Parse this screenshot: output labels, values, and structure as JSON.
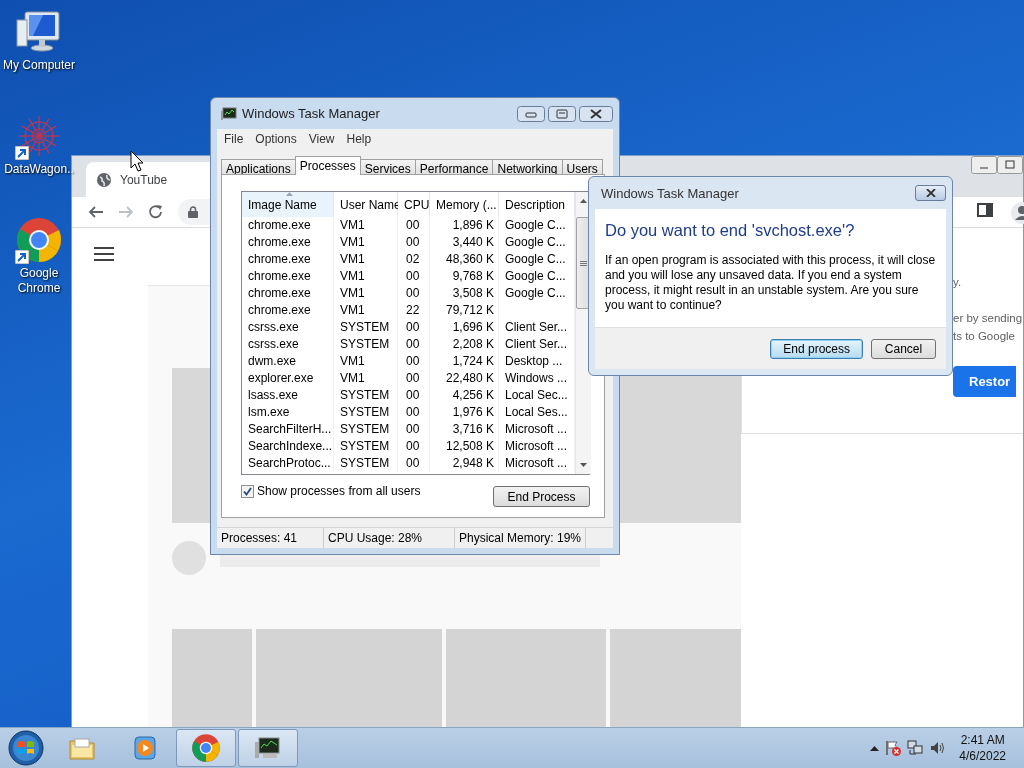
{
  "desktop_icons": [
    {
      "label": "My Computer",
      "kind": "computer",
      "shortcut": false
    },
    {
      "label": "DataWagon..",
      "kind": "network",
      "shortcut": true
    },
    {
      "label": "Google Chrome",
      "kind": "chrome",
      "shortcut": true
    }
  ],
  "browser": {
    "tab_title": "YouTube",
    "panel_texts": [
      "y.",
      "er by sending",
      "ts to Google"
    ],
    "panel_button": "Restor"
  },
  "task_manager": {
    "title": "Windows Task Manager",
    "menu": [
      "File",
      "Options",
      "View",
      "Help"
    ],
    "tabs": [
      {
        "label": "Applications",
        "selected": false
      },
      {
        "label": "Processes",
        "selected": true
      },
      {
        "label": "Services",
        "selected": false
      },
      {
        "label": "Performance",
        "selected": false
      },
      {
        "label": "Networking",
        "selected": false
      },
      {
        "label": "Users",
        "selected": false
      }
    ],
    "columns": [
      {
        "label": "Image Name",
        "sorted": true
      },
      {
        "label": "User Name",
        "sorted": false
      },
      {
        "label": "CPU",
        "sorted": false
      },
      {
        "label": "Memory (...",
        "sorted": false
      },
      {
        "label": "Description",
        "sorted": false
      }
    ],
    "rows": [
      {
        "name": "chrome.exe",
        "user": "VM1",
        "cpu": "00",
        "memory": "1,896 K",
        "description": "Google C..."
      },
      {
        "name": "chrome.exe",
        "user": "VM1",
        "cpu": "00",
        "memory": "3,440 K",
        "description": "Google C..."
      },
      {
        "name": "chrome.exe",
        "user": "VM1",
        "cpu": "02",
        "memory": "48,360 K",
        "description": "Google C..."
      },
      {
        "name": "chrome.exe",
        "user": "VM1",
        "cpu": "00",
        "memory": "9,768 K",
        "description": "Google C..."
      },
      {
        "name": "chrome.exe",
        "user": "VM1",
        "cpu": "00",
        "memory": "3,508 K",
        "description": "Google C..."
      },
      {
        "name": "chrome.exe",
        "user": "VM1",
        "cpu": "22",
        "memory": "79,712 K"
      },
      {
        "name": "csrss.exe",
        "user": "SYSTEM",
        "cpu": "00",
        "memory": "1,696 K",
        "description": "Client Ser..."
      },
      {
        "name": "csrss.exe",
        "user": "SYSTEM",
        "cpu": "00",
        "memory": "2,208 K",
        "description": "Client Ser..."
      },
      {
        "name": "dwm.exe",
        "user": "VM1",
        "cpu": "00",
        "memory": "1,724 K",
        "description": "Desktop ..."
      },
      {
        "name": "explorer.exe",
        "user": "VM1",
        "cpu": "00",
        "memory": "22,480 K",
        "description": "Windows ..."
      },
      {
        "name": "lsass.exe",
        "user": "SYSTEM",
        "cpu": "00",
        "memory": "4,256 K",
        "description": "Local Sec..."
      },
      {
        "name": "lsm.exe",
        "user": "SYSTEM",
        "cpu": "00",
        "memory": "1,976 K",
        "description": "Local Ses..."
      },
      {
        "name": "SearchFilterH...",
        "user": "SYSTEM",
        "cpu": "00",
        "memory": "3,716 K",
        "description": "Microsoft ..."
      },
      {
        "name": "SearchIndexe...",
        "user": "SYSTEM",
        "cpu": "00",
        "memory": "12,508 K",
        "description": "Microsoft ..."
      },
      {
        "name": "SearchProtoc...",
        "user": "SYSTEM",
        "cpu": "00",
        "memory": "2,948 K",
        "description": "Microsoft ..."
      }
    ],
    "show_all": {
      "label": "Show processes from all users",
      "checked": true
    },
    "end_button": "End Process",
    "status_bar": [
      "Processes: 41",
      "CPU Usage: 28%",
      "Physical Memory: 19%"
    ]
  },
  "dialog": {
    "title": "Windows Task Manager",
    "heading": "Do you want to end 'svchost.exe'?",
    "message": "If an open program is associated with this process, it will close and you will lose any unsaved data. If you end a system process, it might result in an unstable system. Are you sure you want to continue?",
    "buttons": [
      {
        "label": "End process",
        "default": true
      },
      {
        "label": "Cancel",
        "default": false
      }
    ]
  },
  "taskbar": {
    "items": [
      {
        "kind": "folder",
        "running": false
      },
      {
        "kind": "media",
        "running": false
      },
      {
        "kind": "chrome",
        "running": true
      },
      {
        "kind": "monitor",
        "running": true
      }
    ],
    "time": "2:41 AM",
    "date": "4/6/2022"
  }
}
